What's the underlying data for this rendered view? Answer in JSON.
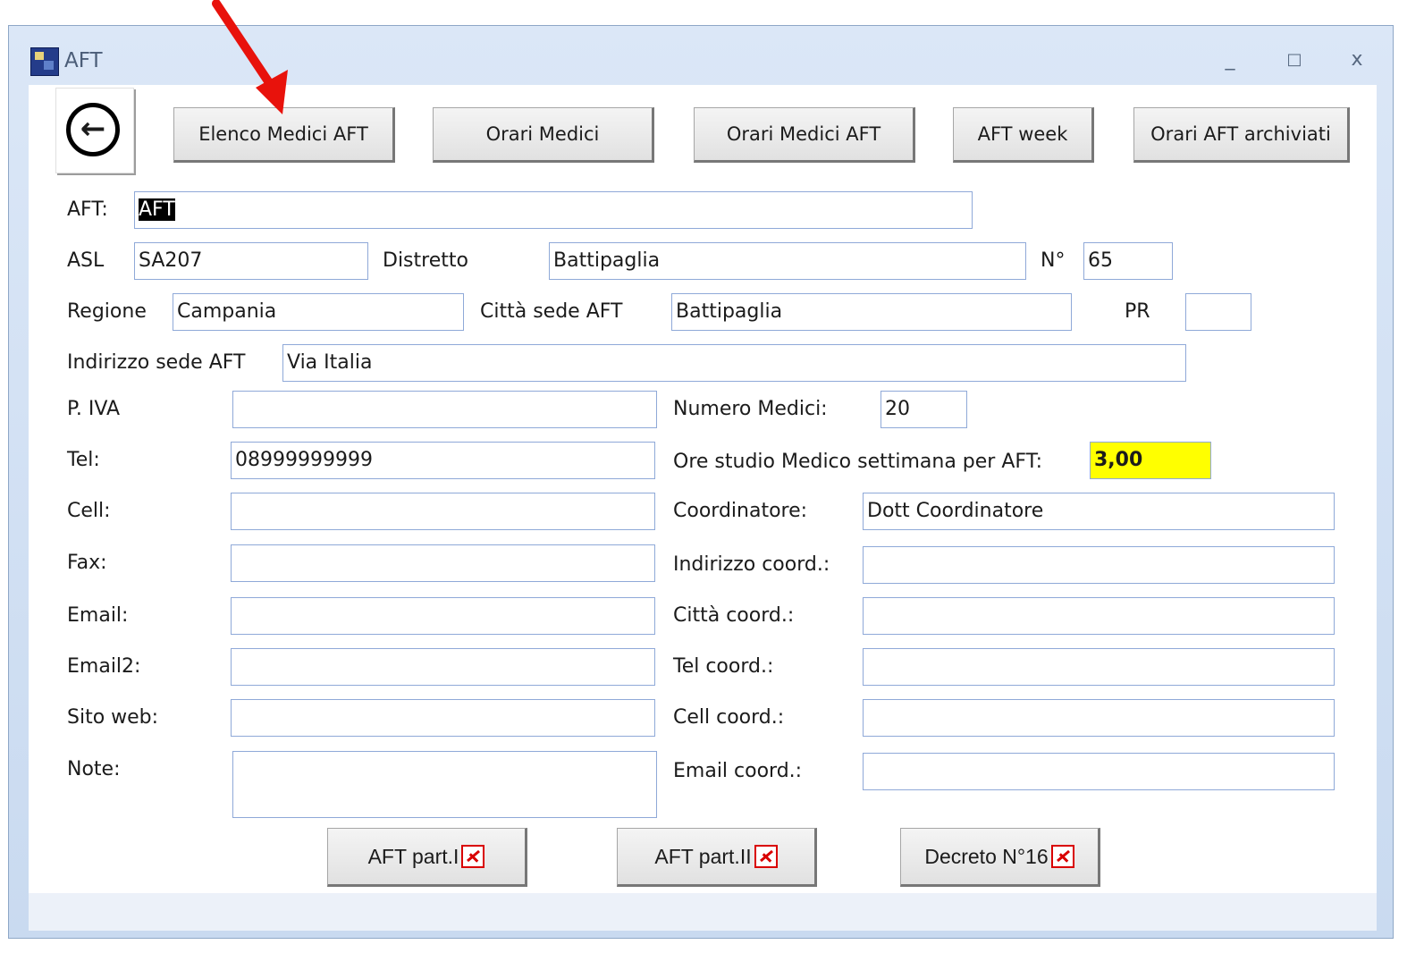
{
  "window": {
    "title": "AFT",
    "minimize": "_",
    "maximize": "□",
    "close": "x"
  },
  "toolbar": {
    "back_icon": "←",
    "buttons": [
      "Elenco Medici AFT",
      "Orari Medici",
      "Orari Medici AFT",
      "AFT week",
      "Orari AFT archiviati"
    ]
  },
  "form": {
    "aft_label": "AFT:",
    "aft_value": "AFT",
    "asl_label": "ASL",
    "asl_value": "SA207",
    "distretto_label": "Distretto",
    "distretto_value": "Battipaglia",
    "num_label": "N°",
    "num_value": "65",
    "regione_label": "Regione",
    "regione_value": "Campania",
    "citta_sede_label": "Città sede AFT",
    "citta_sede_value": "Battipaglia",
    "pr_label": "PR",
    "pr_value": "",
    "indirizzo_label": "Indirizzo sede AFT",
    "indirizzo_value": "Via Italia",
    "piva_label": "P. IVA",
    "piva_value": "",
    "numero_medici_label": "Numero Medici:",
    "numero_medici_value": "20",
    "tel_label": "Tel:",
    "tel_value": "08999999999",
    "ore_label": "Ore studio Medico settimana per AFT:",
    "ore_value": "3,00",
    "cell_label": "Cell:",
    "cell_value": "",
    "coordinatore_label": "Coordinatore:",
    "coordinatore_value": "Dott Coordinatore",
    "fax_label": "Fax:",
    "fax_value": "",
    "indirizzo_coord_label": "Indirizzo coord.:",
    "indirizzo_coord_value": "",
    "email_label": "Email:",
    "email_value": "",
    "citta_coord_label": "Città coord.:",
    "citta_coord_value": "",
    "email2_label": "Email2:",
    "email2_value": "",
    "tel_coord_label": "Tel coord.:",
    "tel_coord_value": "",
    "sito_label": "Sito web:",
    "sito_value": "",
    "cell_coord_label": "Cell coord.:",
    "cell_coord_value": "",
    "note_label": "Note:",
    "note_value": "",
    "email_coord_label": "Email coord.:",
    "email_coord_value": ""
  },
  "pdf_buttons": [
    "AFT part.I",
    "AFT part.II",
    "Decreto N°16"
  ],
  "colors": {
    "annotation_arrow": "#e8120c",
    "highlight_field": "#ffff00",
    "field_border": "#8fa9d8"
  }
}
